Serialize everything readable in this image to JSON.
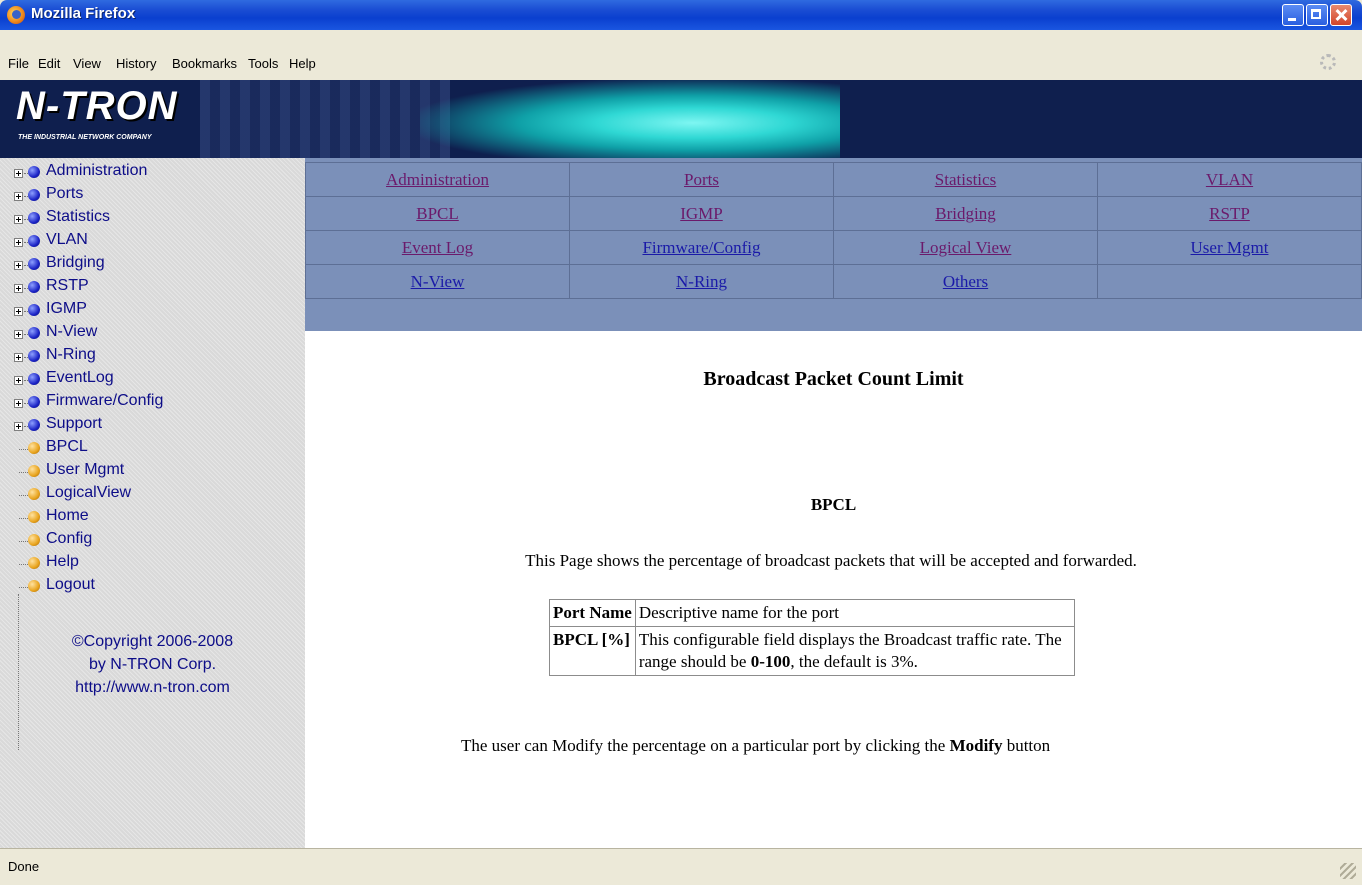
{
  "window": {
    "title": "Mozilla Firefox"
  },
  "menu": [
    "File",
    "Edit",
    "View",
    "History",
    "Bookmarks",
    "Tools",
    "Help"
  ],
  "banner": {
    "brand": "N-TRON",
    "tagline": "THE INDUSTRIAL NETWORK COMPANY"
  },
  "sidebar": {
    "items": [
      {
        "label": "Administration",
        "type": "folder"
      },
      {
        "label": "Ports",
        "type": "folder"
      },
      {
        "label": "Statistics",
        "type": "folder"
      },
      {
        "label": "VLAN",
        "type": "folder"
      },
      {
        "label": "Bridging",
        "type": "folder"
      },
      {
        "label": "RSTP",
        "type": "folder"
      },
      {
        "label": "IGMP",
        "type": "folder"
      },
      {
        "label": "N-View",
        "type": "folder"
      },
      {
        "label": "N-Ring",
        "type": "folder"
      },
      {
        "label": "EventLog",
        "type": "folder"
      },
      {
        "label": "Firmware/Config",
        "type": "folder"
      },
      {
        "label": "Support",
        "type": "folder"
      },
      {
        "label": "BPCL",
        "type": "page"
      },
      {
        "label": "User Mgmt",
        "type": "page"
      },
      {
        "label": "LogicalView",
        "type": "page"
      },
      {
        "label": "Home",
        "type": "page"
      },
      {
        "label": "Config",
        "type": "page"
      },
      {
        "label": "Help",
        "type": "page"
      },
      {
        "label": "Logout",
        "type": "page"
      }
    ],
    "copyright_line1": "©Copyright 2006-2008",
    "copyright_line2": "by N-TRON Corp.",
    "copyright_line3": "http://www.n-tron.com"
  },
  "nav": {
    "rows": [
      [
        "Administration",
        "Ports",
        "Statistics",
        "VLAN"
      ],
      [
        "BPCL",
        "IGMP",
        "Bridging",
        "RSTP"
      ],
      [
        "Event Log",
        "Firmware/Config",
        "Logical View",
        "User Mgmt"
      ],
      [
        "N-View",
        "N-Ring",
        "Others",
        ""
      ]
    ]
  },
  "content": {
    "title": "Broadcast Packet Count Limit",
    "subtitle": "BPCL",
    "description": "This Page shows the percentage of broadcast packets that will be accepted and forwarded.",
    "table": {
      "row1_key": "Port Name",
      "row1_value": "Descriptive name for the port",
      "row2_key": "BPCL [%]",
      "row2_value_a": "This configurable field displays the Broadcast traffic rate. The range should be ",
      "row2_value_range": "0-100",
      "row2_value_b": ", the default is 3%."
    },
    "note_a": "The user can Modify the percentage on a particular port by clicking the ",
    "note_bold": "Modify",
    "note_b": " button"
  },
  "status": {
    "text": "Done"
  },
  "colors": {
    "nav_bg": "#7b90b9",
    "visited_link": "#6b1a6b",
    "link": "#1a1aa8",
    "titlebar": "#0a3fcf"
  }
}
